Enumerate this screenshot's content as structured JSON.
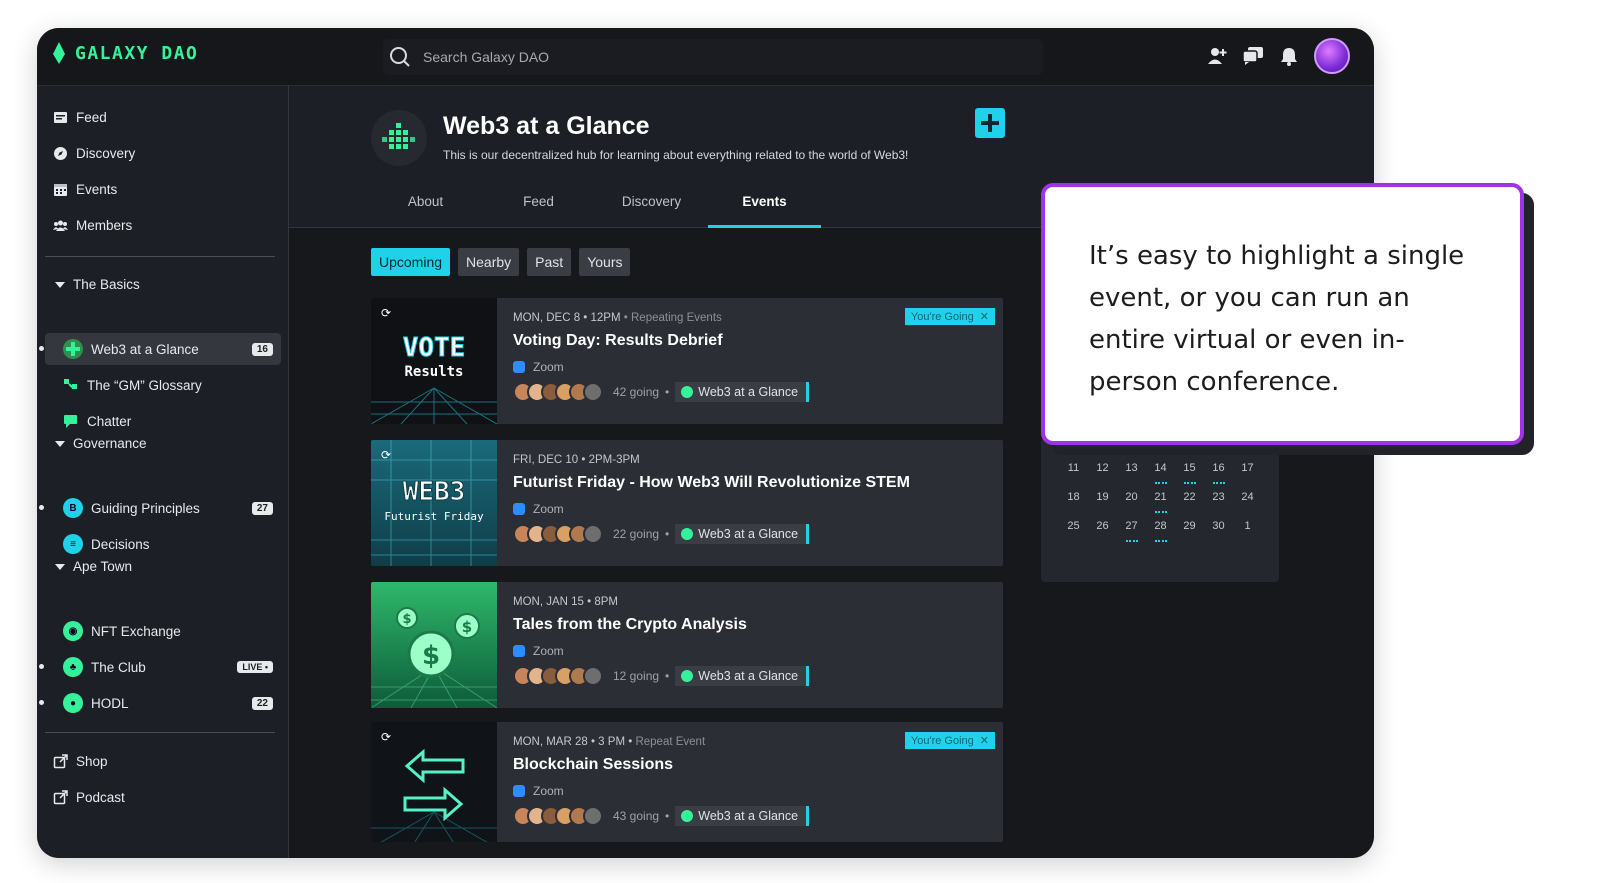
{
  "app": {
    "name": "GALAXY DAO"
  },
  "search": {
    "placeholder": "Search Galaxy DAO"
  },
  "top_icons": [
    "add-friend-icon",
    "chat-icon",
    "bell-icon",
    "avatar"
  ],
  "sidebar": {
    "main_nav": [
      {
        "label": "Feed",
        "icon": "feed-icon"
      },
      {
        "label": "Discovery",
        "icon": "compass-icon"
      },
      {
        "label": "Events",
        "icon": "calendar-icon"
      },
      {
        "label": "Members",
        "icon": "members-icon"
      }
    ],
    "sections": [
      {
        "title": "The Basics",
        "channels": [
          {
            "label": "Web3 at a Glance",
            "badge": "16",
            "active": true,
            "color": "#35f29a"
          },
          {
            "label": "The “GM” Glossary",
            "badge": "",
            "color": "#35f29a"
          },
          {
            "label": "Chatter",
            "badge": "",
            "color": "#35f29a"
          }
        ]
      },
      {
        "title": "Governance",
        "channels": [
          {
            "label": "Guiding Principles",
            "badge": "27",
            "color": "#1fd1e9"
          },
          {
            "label": "Decisions",
            "badge": "",
            "color": "#1fd1e9"
          }
        ]
      },
      {
        "title": "Ape Town",
        "channels": [
          {
            "label": "NFT Exchange",
            "badge": "",
            "color": "#35f29a"
          },
          {
            "label": "The Club",
            "badge": "LIVE •",
            "color": "#35f29a"
          },
          {
            "label": "HODL",
            "badge": "22",
            "color": "#35f29a"
          }
        ]
      }
    ],
    "footer_nav": [
      {
        "label": "Shop",
        "icon": "external-link-icon"
      },
      {
        "label": "Podcast",
        "icon": "external-link-icon"
      }
    ]
  },
  "community": {
    "title": "Web3 at a Glance",
    "description": "This is our decentralized hub for learning about everything related to the world of Web3!",
    "tabs": [
      "About",
      "Feed",
      "Discovery",
      "Events"
    ],
    "active_tab": "Events"
  },
  "filters": [
    "Upcoming",
    "Nearby",
    "Past",
    "Yours"
  ],
  "events": [
    {
      "when": "MON, DEC 8 • 12PM",
      "repeat": "•  Repeating Events",
      "title": "Voting Day: Results Debrief",
      "location": "Zoom",
      "going": "42 going",
      "community": "Web3 at a Glance",
      "going_badge": "You're Going",
      "image_text": [
        "VOTE",
        "Results"
      ]
    },
    {
      "when": "FRI, DEC 10 • 2PM-3PM",
      "repeat": "",
      "title": "Futurist Friday - How Web3 Will Revolutionize STEM",
      "location": "Zoom",
      "going": "22 going",
      "community": "Web3 at a Glance",
      "going_badge": "",
      "image_text": [
        "WEB3",
        "Futurist Friday"
      ]
    },
    {
      "when": "MON, JAN 15  •  8PM",
      "repeat": "",
      "title": "Tales from the Crypto Analysis",
      "location": "Zoom",
      "going": "12 going",
      "community": "Web3 at a Glance",
      "going_badge": "",
      "image_text": []
    },
    {
      "when": "MON, MAR 28 • 3 PM •",
      "repeat": "Repeat Event",
      "title": "Blockchain Sessions",
      "location": "Zoom",
      "going": "43 going",
      "community": "Web3 at a Glance",
      "going_badge": "You're Going",
      "image_text": []
    }
  ],
  "calendar": {
    "rows": [
      [
        "11",
        "12",
        "13",
        "14",
        "15",
        "16",
        "17"
      ],
      [
        "18",
        "19",
        "20",
        "21",
        "22",
        "23",
        "24"
      ],
      [
        "25",
        "26",
        "27",
        "28",
        "29",
        "30",
        "1"
      ]
    ],
    "marked": [
      "14",
      "15",
      "16",
      "21",
      "27",
      "28"
    ]
  },
  "callout": {
    "text": "It’s easy to highlight a single event, or you can run an entire virtual or even in-person conference."
  },
  "colors": {
    "accent": "#1fd1e9",
    "brand_green": "#35f29a",
    "callout_border": "#a132e8"
  }
}
